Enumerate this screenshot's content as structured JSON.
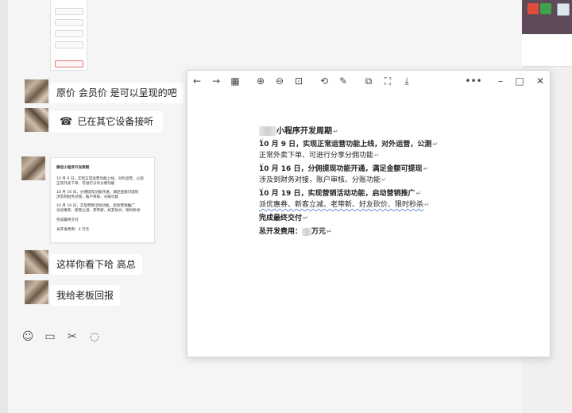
{
  "chat": {
    "messages": [
      {
        "text": "原价 会员价 是可以呈现的吧"
      },
      {
        "text": "已在其它设备接听"
      },
      {
        "text": "这样你看下哈 高总"
      },
      {
        "text": "我给老板回报"
      }
    ],
    "toolbar_icons": [
      "emoji-icon",
      "folder-icon",
      "scissors-icon",
      "chat-bubble-icon"
    ]
  },
  "viewer": {
    "toolbar": {
      "back": "←",
      "forward": "→",
      "grid": "▦",
      "zoom_in": "⊕",
      "zoom_out": "⊖",
      "fit": "⊡",
      "rotate": "⟲",
      "edit": "✎",
      "copy": "⧉",
      "crop": "⛶",
      "save": "⤓",
      "more": "•••",
      "minimize": "–",
      "maximize": "□",
      "close": "✕"
    },
    "doc": {
      "title": "小程序开发周期",
      "p1_heading": "10 月 9 日，实现正常运营功能上线，对外运营，公测",
      "p1_body": "正常外卖下单、可进行分享分佣功能",
      "p2_heading": "10 月 16 日，分佣提现功能开通，满足金额可提现",
      "p2_body": "涉及到财务对接，账户审核、分账功能",
      "p3_heading": "10 月 19 日，实现营销活动功能，启动营销推广",
      "p3_body": "派优惠券、新客立减、老带新、好友砍价、限时秒杀",
      "delivery": "完成最终交付",
      "fee_label": "总开发费用：",
      "fee_unit": "万元"
    }
  },
  "chat_doc_card": {
    "title": "微信小程序开发周期",
    "l1": "10 月 9 日，实现正常运营功能上线，对外运营，公测",
    "l2": "正常外卖下单、可进行分享分佣功能",
    "l3": "10 月 16 日，分佣提现功能开通，满足金额可提现",
    "l4": "涉及到财务对接，账户审核、分账功能",
    "l5": "10 月 19 日，实现营销活动功能，启动营销推广",
    "l6": "派优惠券、新客立减、老带新、好友砍价、限时秒杀",
    "l7": "完成最终交付",
    "l8": "总开发费用：3 万元"
  },
  "colors": {
    "accent_bar": "#5f4a5a",
    "error_button": "#e47474"
  }
}
